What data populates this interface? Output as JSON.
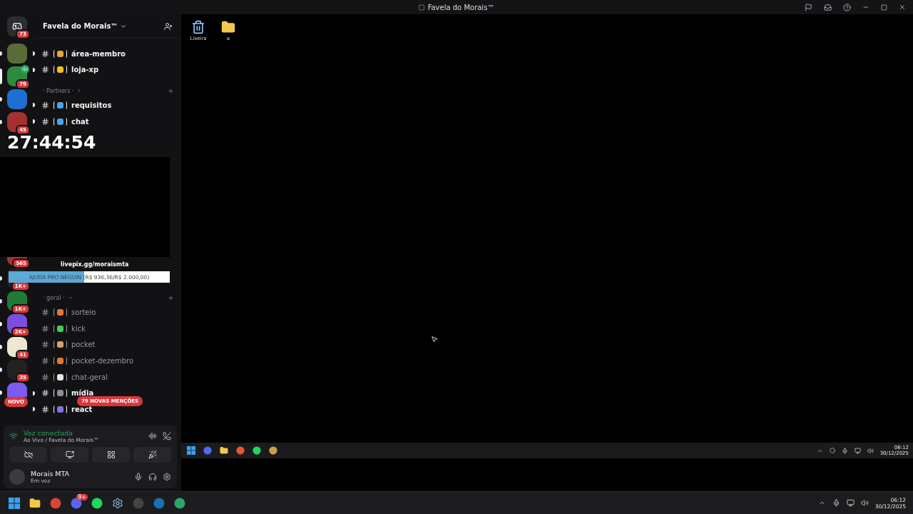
{
  "window": {
    "title": "Favela do Morais™"
  },
  "rail": {
    "top": [
      {
        "kind": "home",
        "badge": "73",
        "unread": false,
        "selected": false,
        "in_voice": false
      },
      {
        "kind": "server",
        "unread": true,
        "selected": false,
        "in_voice": false
      },
      {
        "kind": "server",
        "badge": "79",
        "unread": false,
        "selected": true,
        "in_voice": true
      },
      {
        "kind": "server",
        "unread": true,
        "selected": false,
        "in_voice": false
      },
      {
        "kind": "server",
        "badge": "45",
        "unread": true,
        "selected": false,
        "in_voice": false
      }
    ],
    "bottom": [
      {
        "kind": "server",
        "badge": "565",
        "unread": false,
        "selected": false
      },
      {
        "kind": "server",
        "badge": "1K+",
        "unread": true,
        "selected": false,
        "in_voice": false
      },
      {
        "kind": "server",
        "badge": "1K+",
        "unread": true,
        "selected": false,
        "in_voice": false
      },
      {
        "kind": "server",
        "badge": "2K+",
        "unread": true,
        "selected": false,
        "in_voice": false
      },
      {
        "kind": "server",
        "badge": "41",
        "unread": true,
        "selected": false,
        "in_voice": false
      },
      {
        "kind": "server",
        "badge": "35",
        "unread": true,
        "selected": false,
        "in_voice": false
      },
      {
        "kind": "server",
        "label": "NOVO",
        "unread": true,
        "selected": false,
        "in_voice": false
      }
    ]
  },
  "server": {
    "name": "Favela do Morais™"
  },
  "sections": [
    {
      "channels": [
        {
          "name": "área-membro",
          "unread": true,
          "color": "#e8a33d"
        },
        {
          "name": "loja-xp",
          "unread": true,
          "color": "#f0c419"
        }
      ]
    },
    {
      "category": "· Partners ·",
      "expanded": false,
      "channels": [
        {
          "name": "requisitos",
          "unread": true,
          "color": "#4aa3ef"
        },
        {
          "name": "chat",
          "unread": true,
          "color": "#4aa3ef"
        }
      ]
    },
    {
      "category": "· geral ·",
      "expanded": true,
      "channels": [
        {
          "name": "sorteio",
          "unread": false,
          "color": "#e8782e"
        },
        {
          "name": "kick",
          "unread": false,
          "color": "#3ecf5b"
        },
        {
          "name": "pocket",
          "unread": false,
          "color": "#d9a06b"
        },
        {
          "name": "pocket-dezembro",
          "unread": false,
          "color": "#e8782e"
        },
        {
          "name": "chat-geral",
          "unread": false,
          "color": "#e6e6e6"
        },
        {
          "name": "mídia",
          "unread": true,
          "color": "#8a8f98"
        },
        {
          "name": "react",
          "unread": true,
          "color": "#8a6fd8"
        }
      ]
    }
  ],
  "mentions": "79 NOVAS MENÇÕES",
  "stream_overlay": {
    "timer": "27:44:54",
    "link": "livepix.gg/moraismta",
    "goal": {
      "label": "AJUDA PRO NEGUIN (R$ 936,36/R$ 2.000,00)",
      "level": 0.47
    }
  },
  "voice": {
    "status": "Voz conectada",
    "channel": "Ao Vivo / Favela do Morais™"
  },
  "user": {
    "name": "Morais MTA",
    "status": "Em voz"
  },
  "desktop": {
    "icons": [
      {
        "kind": "trash",
        "label": "Lixeira"
      },
      {
        "kind": "folder",
        "label": "a"
      }
    ],
    "taskbar": {
      "time": "06:12",
      "date": "30/12/2025"
    }
  },
  "taskbar": {
    "chat_badge": "9+",
    "time": "06:12",
    "date": "30/12/2025"
  }
}
